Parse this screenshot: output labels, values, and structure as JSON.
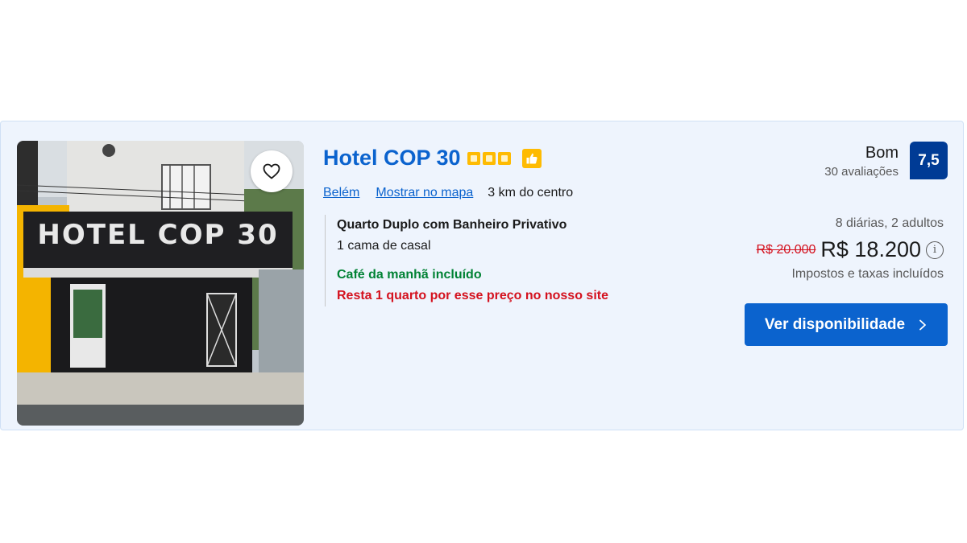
{
  "hotel": {
    "name": "Hotel COP 30",
    "stars": 3,
    "location_link": "Belém",
    "map_link": "Mostrar no mapa",
    "distance": "3 km do centro",
    "photo_sign": "HOTEL COP 30"
  },
  "room": {
    "name": "Quarto Duplo com Banheiro Privativo",
    "bed": "1 cama de casal",
    "breakfast": "Café da manhã incluído",
    "availability_warning": "Resta 1 quarto por esse preço no nosso site"
  },
  "rating": {
    "word": "Bom",
    "count": "30 avaliações",
    "score": "7,5"
  },
  "price": {
    "stay_info": "8 diárias, 2 adultos",
    "original": "R$ 20.000",
    "current": "R$ 18.200",
    "taxes": "Impostos e taxas incluídos"
  },
  "cta": {
    "label": "Ver disponibilidade"
  },
  "icons": {
    "favorite": "heart-icon",
    "info": "info-icon",
    "thumbs_up": "thumbs-up-icon",
    "chevron": "chevron-right-icon"
  },
  "colors": {
    "brand_blue": "#0b63ce",
    "score_blue": "#003b95",
    "star_yellow": "#febb02",
    "green": "#008234",
    "red": "#d4111e",
    "card_bg": "#eef4fd"
  }
}
